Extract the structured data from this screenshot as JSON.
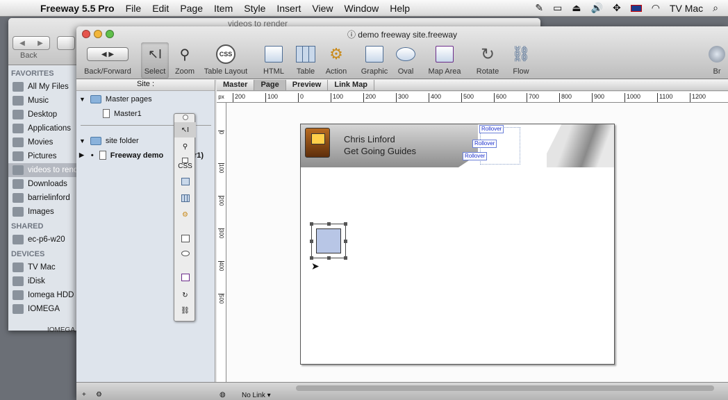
{
  "menubar": {
    "app_name": "Freeway 5.5 Pro",
    "menus": [
      "File",
      "Edit",
      "Page",
      "Item",
      "Style",
      "Insert",
      "View",
      "Window",
      "Help"
    ],
    "user": "TV Mac"
  },
  "finder": {
    "title": "videos to render",
    "back_label": "Back",
    "sections": [
      {
        "title": "FAVORITES",
        "items": [
          "All My Files",
          "Music",
          "Desktop",
          "Applications",
          "Movies",
          "Pictures",
          "videos to render",
          "Downloads",
          "barrielinford",
          "Images"
        ]
      },
      {
        "title": "SHARED",
        "items": [
          "ec-p6-w20"
        ]
      },
      {
        "title": "DEVICES",
        "items": [
          "TV Mac",
          "iDisk",
          "Iomega HDD",
          "IOMEGA"
        ]
      }
    ],
    "selected_item": "videos to render",
    "bottom_label": "IOMEGA"
  },
  "window": {
    "title": "demo freeway site.freeway",
    "toolbar": [
      {
        "label": "Back/Forward",
        "icon": "back-forward-icon"
      },
      {
        "label": "Select",
        "icon": "select-arrow-icon"
      },
      {
        "label": "Zoom",
        "icon": "zoom-icon"
      },
      {
        "label": "Table Layout",
        "icon": "css-icon",
        "glyph": "CSS"
      },
      {
        "label": "HTML",
        "icon": "html-box-icon"
      },
      {
        "label": "Table",
        "icon": "table-icon"
      },
      {
        "label": "Action",
        "icon": "action-gear-icon"
      },
      {
        "label": "Graphic",
        "icon": "graphic-box-icon"
      },
      {
        "label": "Oval",
        "icon": "oval-icon"
      },
      {
        "label": "Map Area",
        "icon": "map-area-icon"
      },
      {
        "label": "Rotate",
        "icon": "rotate-icon"
      },
      {
        "label": "Flow",
        "icon": "flow-icon"
      },
      {
        "label": "Br",
        "icon": "browser-icon"
      }
    ],
    "site_panel": {
      "header": "Site :",
      "master_folder": "Master pages",
      "master_page": "Master1",
      "site_folder": "site folder",
      "page_name": "Freeway demo",
      "page_suffix": "ter1)"
    },
    "tabs": [
      "Master",
      "Page",
      "Preview",
      "Link Map"
    ],
    "active_tab": "Page",
    "ruler_unit": "px",
    "ruler_labels": [
      "200",
      "100",
      "0",
      "100",
      "200",
      "300",
      "400",
      "500",
      "600",
      "700",
      "800",
      "900",
      "1000",
      "1100",
      "1200"
    ],
    "vruler_labels": [
      "0",
      "100",
      "200",
      "300",
      "400",
      "500"
    ],
    "page": {
      "banner_line1": "Chris Linford",
      "banner_line2": "Get Going Guides",
      "rollover_label": "Rollover"
    },
    "palette_tools": [
      "select-arrow",
      "zoom",
      "css",
      "html-box",
      "table",
      "action-gear",
      "graphic-box",
      "oval",
      "map-area",
      "rotate",
      "flow"
    ],
    "status": {
      "link_label": "No Link"
    }
  },
  "colors": {
    "selection": "#3a7bd5",
    "rollover_text": "#1a2ecc"
  }
}
